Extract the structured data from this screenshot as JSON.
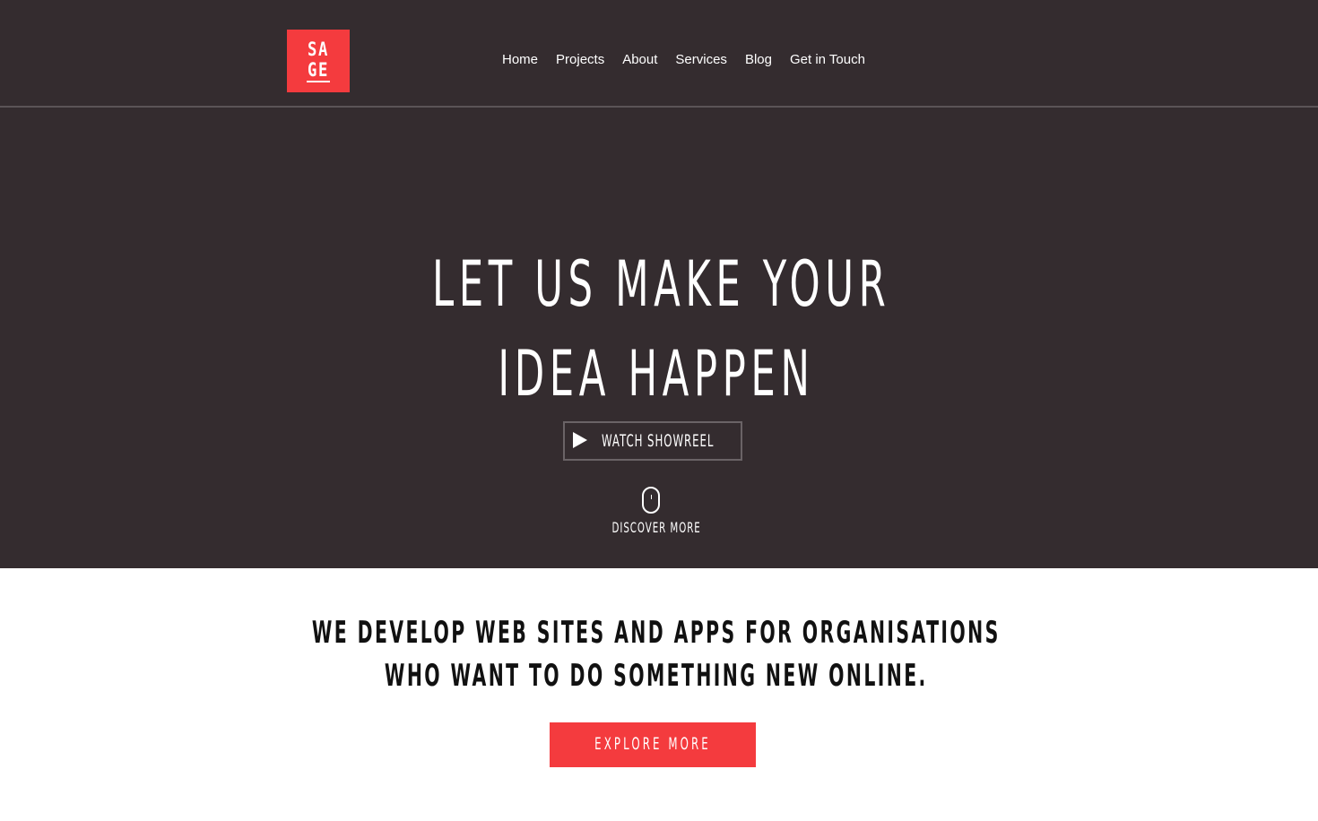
{
  "brand": {
    "logo_line1": "SA",
    "logo_line2": "GE",
    "accent_color": "#f43b3e",
    "hero_background": "#342c2f"
  },
  "nav": {
    "items": [
      {
        "label": "Home"
      },
      {
        "label": "Projects"
      },
      {
        "label": "About"
      },
      {
        "label": "Services"
      },
      {
        "label": "Blog"
      },
      {
        "label": "Get in Touch"
      }
    ]
  },
  "hero": {
    "headline_line1": "LET US MAKE YOUR",
    "headline_line2": "IDEA HAPPEN",
    "showreel": {
      "icon": "play-icon",
      "label": "WATCH SHOWREEL"
    },
    "discover": {
      "icon": "mouse-scroll-icon",
      "label": "DISCOVER MORE"
    }
  },
  "intro": {
    "tagline_line1": "WE DEVELOP WEB SITES AND APPS FOR ORGANISATIONS",
    "tagline_line2": "WHO WANT TO DO SOMETHING NEW ONLINE.",
    "cta_label": "EXPLORE MORE"
  }
}
